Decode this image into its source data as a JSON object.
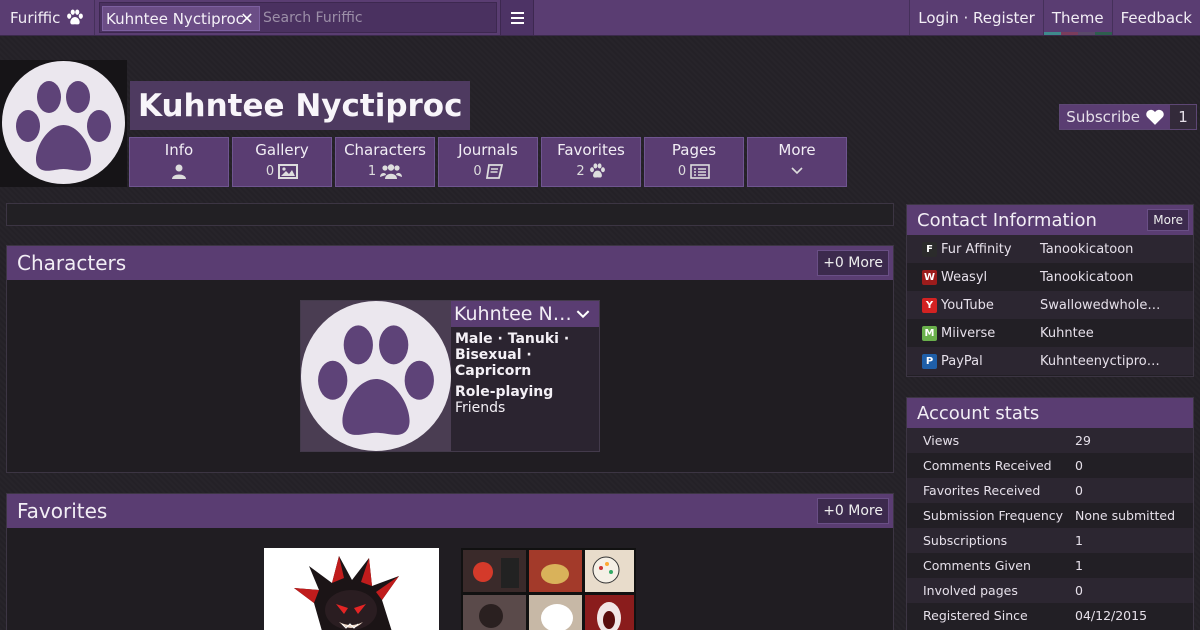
{
  "topbar": {
    "brand": "Furiffic",
    "search_tag": "Kuhntee Nyctiproc",
    "search_placeholder": "Search Furiffic",
    "login_register": "Login · Register",
    "theme": "Theme",
    "feedback": "Feedback",
    "theme_colors": [
      "#3f8a8c",
      "#7a3c5c",
      "#5a4a6a",
      "#2e5e4e"
    ]
  },
  "profile": {
    "username": "Kuhntee Nyctiproc",
    "subscribe_label": "Subscribe",
    "subscribe_count": "1"
  },
  "tabs": [
    {
      "label": "Info",
      "count": "",
      "icon": "user-icon"
    },
    {
      "label": "Gallery",
      "count": "0",
      "icon": "image-icon"
    },
    {
      "label": "Characters",
      "count": "1",
      "icon": "users-icon"
    },
    {
      "label": "Journals",
      "count": "0",
      "icon": "book-icon"
    },
    {
      "label": "Favorites",
      "count": "2",
      "icon": "paw-icon"
    },
    {
      "label": "Pages",
      "count": "0",
      "icon": "list-icon"
    },
    {
      "label": "More",
      "count": "",
      "icon": "chevron-down-icon"
    }
  ],
  "characters_panel": {
    "title": "Characters",
    "more": "+0 More",
    "character": {
      "name": "Kuhntee N…",
      "traits": "Male · Tanuki · Bisexual · Capricorn",
      "roleplay_label": "Role-playing",
      "roleplay_value": "Friends"
    }
  },
  "favorites_panel": {
    "title": "Favorites",
    "more": "+0 More"
  },
  "contact": {
    "title": "Contact Information",
    "more": "More",
    "items": [
      {
        "site": "Fur Affinity",
        "handle": "Tanookicatoon",
        "icon": "furaffinity-icon",
        "color": "#2b2b2b"
      },
      {
        "site": "Weasyl",
        "handle": "Tanookicatoon",
        "icon": "weasyl-icon",
        "color": "#9c1c1c"
      },
      {
        "site": "YouTube",
        "handle": "Swallowedwhole…",
        "icon": "youtube-icon",
        "color": "#d32222"
      },
      {
        "site": "Miiverse",
        "handle": "Kuhntee",
        "icon": "miiverse-icon",
        "color": "#6ab04c"
      },
      {
        "site": "PayPal",
        "handle": "Kuhnteenyctipro…",
        "icon": "paypal-icon",
        "color": "#1f5fa8"
      }
    ]
  },
  "stats": {
    "title": "Account stats",
    "items": [
      {
        "label": "Views",
        "value": "29"
      },
      {
        "label": "Comments Received",
        "value": "0"
      },
      {
        "label": "Favorites Received",
        "value": "0"
      },
      {
        "label": "Submission Frequency",
        "value": "None submitted"
      },
      {
        "label": "Subscriptions",
        "value": "1"
      },
      {
        "label": "Comments Given",
        "value": "1"
      },
      {
        "label": "Involved pages",
        "value": "0"
      },
      {
        "label": "Registered Since",
        "value": "04/12/2015"
      }
    ]
  }
}
